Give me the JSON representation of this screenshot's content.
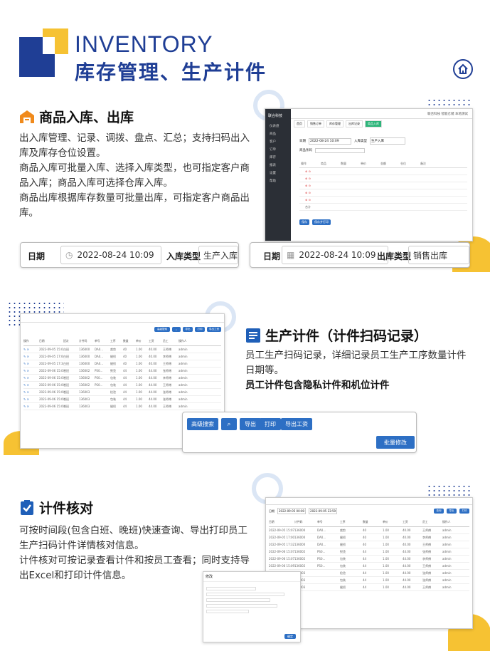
{
  "header": {
    "title_en": "INVENTORY",
    "title_cn": "库存管理、生产计件"
  },
  "section1": {
    "title": "商品入库、出库",
    "paragraphs": [
      "出入库管理、记录、调拨、盘点、汇总；支持扫码出入库及库存仓位设置。",
      "商品入库可批量入库、选择入库类型，也可指定客户商品入库；商品入库可选择仓库入库。",
      "商品出库根据库存数量可批量出库，可指定客户商品出库。"
    ],
    "field_in": {
      "date_label": "日期",
      "date_value": "2022-08-24 10:09",
      "type_label": "入库类型",
      "type_value": "生产入库"
    },
    "field_out": {
      "date_label": "日期",
      "date_value": "2022-08-24 10:09",
      "type_label": "出库类型",
      "type_value": "销售出库"
    },
    "app": {
      "brand": "联合科技",
      "company": "联合科技 智能仓储 本地测试",
      "tabs": [
        "首页",
        "销售订单",
        "库存管理",
        "出库记录",
        "商品入库"
      ],
      "sidebar": [
        "仪表盘",
        "商品",
        "客户",
        "订单",
        "库存",
        "报表",
        "设置",
        "帮助"
      ],
      "form_date_label": "日期",
      "form_date": "2022-08-24 10:09",
      "form_type_label": "入库类型",
      "form_type": "生产入库",
      "scan_label": "商品条码",
      "col_headers": [
        "操作",
        "商品",
        "数量",
        "单价",
        "金额",
        "仓位",
        "备注"
      ],
      "total_label": "合计",
      "btn_save": "保存",
      "btn_save_print": "保存并打印"
    }
  },
  "section2": {
    "title": "生产计件（计件扫码记录）",
    "paragraphs": [
      "员工生产扫码记录，详细记录员工生产工序数量计件日期等。"
    ],
    "bold": "员工计件包含隐私计件和机位计件",
    "toolbar": {
      "advanced_search": "高级搜索",
      "search_icon": "search-icon",
      "export": "导出",
      "print": "打印",
      "export_wage": "导出工资",
      "batch_edit": "批量修改"
    },
    "table": {
      "headers": [
        "操作",
        "日期",
        "班次",
        "计件码",
        "单号",
        "工序",
        "数量",
        "单价",
        "工资",
        "员工",
        "操作人"
      ],
      "rows": [
        [
          "2022-09-05 15:07",
          "白班",
          "136000",
          "DA0...",
          "裁剪",
          "40",
          "1.00",
          "40.00",
          "王师傅",
          "admin"
        ],
        [
          "2022-09-05 17:00",
          "白班",
          "136000",
          "DA0...",
          "缝纫",
          "40",
          "1.00",
          "40.00",
          "李师傅",
          "admin"
        ],
        [
          "2022-09-05 17:32",
          "白班",
          "136000",
          "DA0...",
          "缝纫",
          "40",
          "1.00",
          "40.00",
          "王师傅",
          "admin"
        ],
        [
          "2022-09-06 15:07",
          "晚班",
          "136002",
          "PS0...",
          "熨烫",
          "44",
          "1.00",
          "44.00",
          "张师傅",
          "admin"
        ],
        [
          "2022-09-06 15:07",
          "晚班",
          "136002",
          "PS0...",
          "包装",
          "44",
          "1.00",
          "44.00",
          "李师傅",
          "admin"
        ],
        [
          "2022-09-06 15:09",
          "晚班",
          "136002",
          "PS0...",
          "包装",
          "44",
          "1.00",
          "44.00",
          "王师傅",
          "admin"
        ],
        [
          "2022-09-06 15:09",
          "晚班",
          "136003",
          "",
          "检验",
          "44",
          "1.00",
          "44.00",
          "张师傅",
          "admin"
        ],
        [
          "2022-09-06 15:09",
          "晚班",
          "136003",
          "",
          "包装",
          "44",
          "1.00",
          "44.00",
          "张师傅",
          "admin"
        ],
        [
          "2022-09-06 15:09",
          "晚班",
          "136003",
          "",
          "缝纫",
          "44",
          "1.00",
          "44.00",
          "王师傅",
          "admin"
        ]
      ]
    }
  },
  "section3": {
    "title": "计件核对",
    "paragraphs": [
      "可按时间段(包含白班、晚班)快速查询、导出打印员工生产扫码计件详情核对信息。",
      "计件核对可按记录查看计件和按员工查看；同时支持导出Excel和打印计件信息。"
    ],
    "table": {
      "date_label": "日期",
      "date_from": "2022-09-05 00:00",
      "date_to": "2022-09-05 23:59",
      "btn_query": "查询",
      "btn_export": "导出",
      "btn_print": "打印",
      "headers": [
        "日期",
        "计件码",
        "单号",
        "工序",
        "数量",
        "单价",
        "工资",
        "员工",
        "操作人"
      ],
      "rows": [
        [
          "2022-09-05 15:07",
          "136000",
          "DA0...",
          "裁剪",
          "40",
          "1.00",
          "40.00",
          "王师傅",
          "admin"
        ],
        [
          "2022-09-05 17:00",
          "136000",
          "DA0...",
          "缝纫",
          "40",
          "1.00",
          "40.00",
          "李师傅",
          "admin"
        ],
        [
          "2022-09-05 17:32",
          "136000",
          "DA0...",
          "缝纫",
          "40",
          "1.00",
          "40.00",
          "王师傅",
          "admin"
        ],
        [
          "2022-09-06 15:07",
          "136002",
          "PS0...",
          "熨烫",
          "44",
          "1.00",
          "44.00",
          "张师傅",
          "admin"
        ],
        [
          "2022-09-06 15:07",
          "136002",
          "PS0...",
          "包装",
          "44",
          "1.00",
          "44.00",
          "李师傅",
          "admin"
        ],
        [
          "2022-09-06 15:09",
          "136002",
          "PS0...",
          "包装",
          "44",
          "1.00",
          "44.00",
          "王师傅",
          "admin"
        ],
        [
          "2022-09-06 15:09",
          "136003",
          "",
          "检验",
          "44",
          "1.00",
          "44.00",
          "张师傅",
          "admin"
        ],
        [
          "2022-09-06 15:09",
          "136003",
          "",
          "包装",
          "44",
          "1.00",
          "44.00",
          "张师傅",
          "admin"
        ],
        [
          "2022-09-06 15:09",
          "136003",
          "",
          "缝纫",
          "44",
          "1.00",
          "44.00",
          "王师傅",
          "admin"
        ]
      ],
      "pager": "1"
    },
    "dialog": {
      "title": "修改",
      "btn_ok": "确定"
    }
  },
  "colors": {
    "brand_blue": "#1f3e95",
    "accent_yellow": "#f6c233",
    "button_blue": "#2d6fc4"
  }
}
